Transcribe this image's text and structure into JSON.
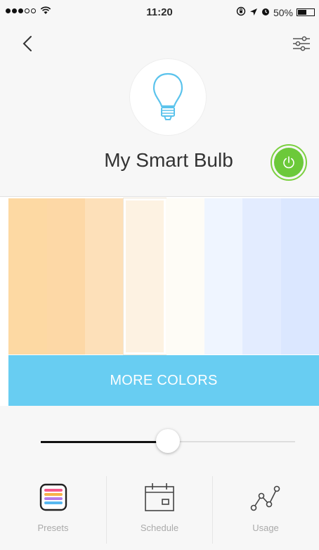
{
  "status_bar": {
    "time": "11:20",
    "battery": "50%",
    "battery_level": 0.5,
    "signal_icon": "signal-dots-icon",
    "wifi_icon": "wifi-icon",
    "extra_icons": [
      "rotation-lock-icon",
      "location-icon",
      "alarm-icon"
    ]
  },
  "header": {
    "back_icon": "chevron-left-icon",
    "settings_icon": "sliders-icon",
    "device_icon": "bulb-icon",
    "device_name": "My Smart Bulb",
    "power_icon": "power-icon",
    "power_on": true
  },
  "colors": {
    "swatches": [
      "#fdd9a3",
      "#fdd8a6",
      "#fde0b9",
      "#fdf2e2",
      "#fefcf6",
      "#eff5ff",
      "#e3ecff",
      "#dbe7ff"
    ],
    "selected_index": 3,
    "more_label": "MORE COLORS",
    "accent": "#68cdf2"
  },
  "brightness": {
    "level": 0.5
  },
  "tabs": [
    {
      "label": "Presets",
      "icon": "presets-icon"
    },
    {
      "label": "Schedule",
      "icon": "calendar-icon"
    },
    {
      "label": "Usage",
      "icon": "usage-graph-icon"
    }
  ]
}
